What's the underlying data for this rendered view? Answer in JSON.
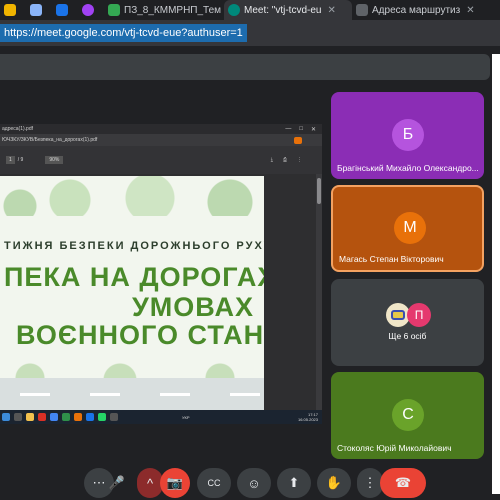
{
  "browser": {
    "tabs": [
      {
        "label": "",
        "color": "#f0b400"
      },
      {
        "label": "",
        "color": "#8ab4f8"
      },
      {
        "label": "",
        "color": "#1a73e8"
      },
      {
        "label": "",
        "color": "#a142f4"
      },
      {
        "label": "ПЗ_8_КММРНП_Тем",
        "color": "#34a853"
      },
      {
        "label": "Meet: \"vtj-tcvd-eu",
        "color": "#00897b",
        "active": true
      },
      {
        "label": "Адреса маршрутиз",
        "color": "#5f6368"
      }
    ],
    "url": "https://meet.google.com/vtj-tcvd-eue?authuser=1"
  },
  "presentation": {
    "pdf_tab_title": "адреса(1).pdf",
    "pdf_path": "ЮЧЗКУ/ЗКУВ/Безпека_на_дорогах(1).pdf",
    "page_current": "1",
    "page_total": "/ 9",
    "zoom": "90%",
    "slide": {
      "line1": "ТИЖНЯ БЕЗПЕКИ ДОРОЖНЬОГО РУХУ",
      "line2": "ПЕКА НА ДОРОГАХ В",
      "line3": "УМОВАХ",
      "line4": "ВОЄННОГО СТАНУ»"
    },
    "taskbar_time": "17:17",
    "taskbar_date": "16.05.2023",
    "taskbar_lang": "УКР"
  },
  "participants": [
    {
      "initial": "Б",
      "name": "Брагінський Михайло Олександро..."
    },
    {
      "initial": "М",
      "name": "Магась Степан Вікторович"
    },
    {
      "initial": "П",
      "name": "Ще 6 осіб"
    },
    {
      "initial": "С",
      "name": "Стоколяс Юрій Миколайович"
    }
  ],
  "controls": {
    "more": "⋯",
    "mic": "🎤",
    "chevron": "^",
    "camera_off": "📷",
    "captions": "CC",
    "emoji": "☺",
    "present": "⬆",
    "raise_hand": "✋",
    "more_options": "⋮",
    "leave": "☎"
  },
  "colors": {
    "accent": "#e8710a",
    "leave": "#ea4335"
  }
}
